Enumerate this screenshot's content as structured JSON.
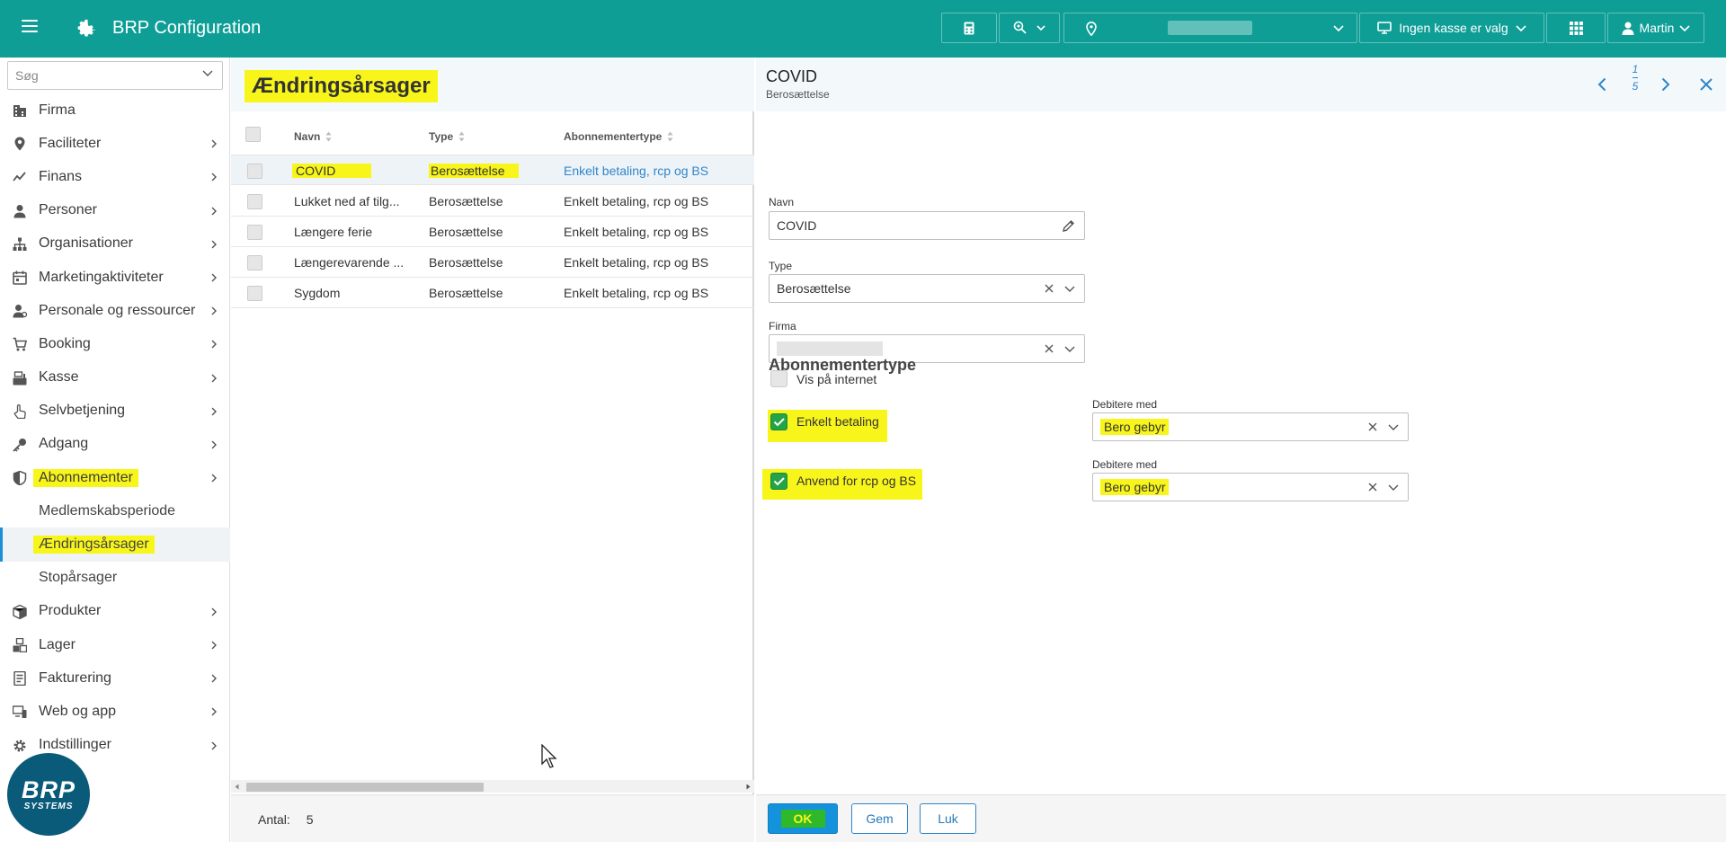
{
  "topbar": {
    "title": "BRP Configuration",
    "register_label": "Ingen kasse er valg",
    "user_label": "Martin",
    "icons": [
      "menu-icon",
      "gear-icon",
      "calculator-icon",
      "location-tag-icon",
      "map-pin-icon",
      "monitor-icon",
      "apps-grid-icon",
      "user-icon"
    ]
  },
  "sidebar": {
    "search_placeholder": "Søg",
    "items": [
      {
        "label": "Firma",
        "icon": "building-icon"
      },
      {
        "label": "Faciliteter",
        "icon": "map-pin-icon"
      },
      {
        "label": "Finans",
        "icon": "chart-line-icon"
      },
      {
        "label": "Personer",
        "icon": "person-icon"
      },
      {
        "label": "Organisationer",
        "icon": "org-chart-icon"
      },
      {
        "label": "Marketingaktiviteter",
        "icon": "calendar-icon"
      },
      {
        "label": "Personale og ressourcer",
        "icon": "staff-icon"
      },
      {
        "label": "Booking",
        "icon": "cart-icon"
      },
      {
        "label": "Kasse",
        "icon": "cash-register-icon"
      },
      {
        "label": "Selvbetjening",
        "icon": "hand-pointer-icon"
      },
      {
        "label": "Adgang",
        "icon": "key-icon"
      },
      {
        "label": "Abonnementer",
        "icon": "shield-icon"
      },
      {
        "label": "Medlemskabsperiode"
      },
      {
        "label": "Ændringsårsager"
      },
      {
        "label": "Stopårsager"
      },
      {
        "label": "Produkter",
        "icon": "box-icon"
      },
      {
        "label": "Lager",
        "icon": "boxes-icon"
      },
      {
        "label": "Fakturering",
        "icon": "invoice-icon"
      },
      {
        "label": "Web og app",
        "icon": "devices-icon"
      },
      {
        "label": "Indstillinger",
        "icon": "gear-icon"
      }
    ],
    "logo": {
      "line1": "BRP",
      "line2": "SYSTEMS"
    }
  },
  "list": {
    "title": "Ændringsårsager",
    "columns": [
      "Navn",
      "Type",
      "Abonnementertype"
    ],
    "rows": [
      {
        "navn": "COVID",
        "type": "Berosættelse",
        "abonnementertype": "Enkelt betaling, rcp og BS"
      },
      {
        "navn": "Lukket ned af tilg...",
        "type": "Berosættelse",
        "abonnementertype": "Enkelt betaling, rcp og BS"
      },
      {
        "navn": "Længere ferie",
        "type": "Berosættelse",
        "abonnementertype": "Enkelt betaling, rcp og BS"
      },
      {
        "navn": "Længerevarende ...",
        "type": "Berosættelse",
        "abonnementertype": "Enkelt betaling, rcp og BS"
      },
      {
        "navn": "Sygdom",
        "type": "Berosættelse",
        "abonnementertype": "Enkelt betaling, rcp og BS"
      }
    ],
    "count_label": "Antal:",
    "count_value": "5"
  },
  "detail": {
    "title": "COVID",
    "subtitle": "Berosættelse",
    "pager_current": "1",
    "pager_total": "5",
    "navn_label": "Navn",
    "navn_value": "COVID",
    "type_label": "Type",
    "type_value": "Berosættelse",
    "firma_label": "Firma",
    "vis_label": "Vis på internet",
    "section_title": "Abonnementertype",
    "subs": [
      {
        "label": "Enkelt betaling",
        "debit_label": "Debitere med",
        "debit_value": "Bero gebyr"
      },
      {
        "label": "Anvend for rcp og BS",
        "debit_label": "Debitere med",
        "debit_value": "Bero gebyr"
      }
    ],
    "buttons": {
      "ok": "OK",
      "gem": "Gem",
      "luk": "Luk"
    }
  },
  "colors": {
    "topbar": "#0e9e96",
    "accent": "#1592dc",
    "highlight": "#f8f51a",
    "link": "#2f86c9",
    "check": "#22a447"
  }
}
